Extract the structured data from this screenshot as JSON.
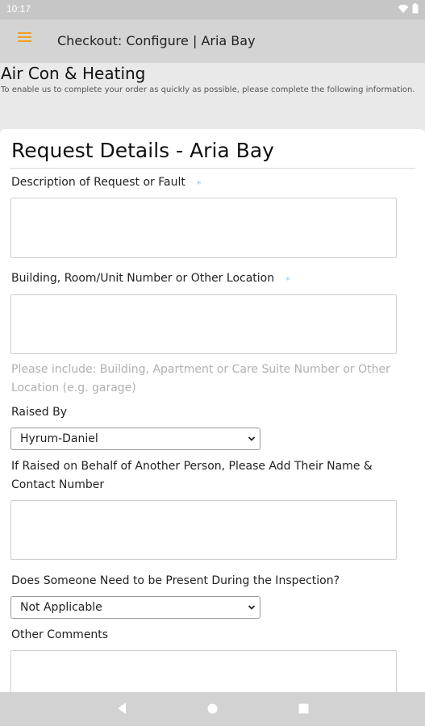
{
  "status_bar": {
    "time": "10:17"
  },
  "app_bar": {
    "title": "Checkout: Configure | Aria Bay"
  },
  "intro": {
    "title": "Air Con & Heating",
    "text": "To enable us to complete your order as quickly as possible, please complete the following information."
  },
  "form": {
    "title": "Request Details - Aria Bay",
    "required_marker": "*",
    "description_label": "Description of Request or Fault",
    "location_label": "Building, Room/Unit Number or Other Location",
    "location_hint": "Please include: Building, Apartment or Care Suite Number or Other Location (e.g. garage)",
    "raised_by_label": "Raised By",
    "raised_by_value": "Hyrum-Daniel",
    "behalf_label": "If Raised on Behalf of Another Person, Please Add Their Name & Contact Number",
    "present_label": "Does Someone Need to be Present During the Inspection?",
    "present_value": "Not Applicable",
    "comments_label": "Other Comments"
  },
  "colors": {
    "menu_icon": "#f0a020",
    "required_star": "#8cc4f0",
    "app_bar": "#d4d4d4",
    "background": "#e9e9e9"
  },
  "icons": {
    "menu": "menu-icon",
    "wifi": "wifi-icon",
    "battery": "battery-icon",
    "back": "back-icon",
    "home": "home-icon",
    "recents": "recents-icon"
  }
}
